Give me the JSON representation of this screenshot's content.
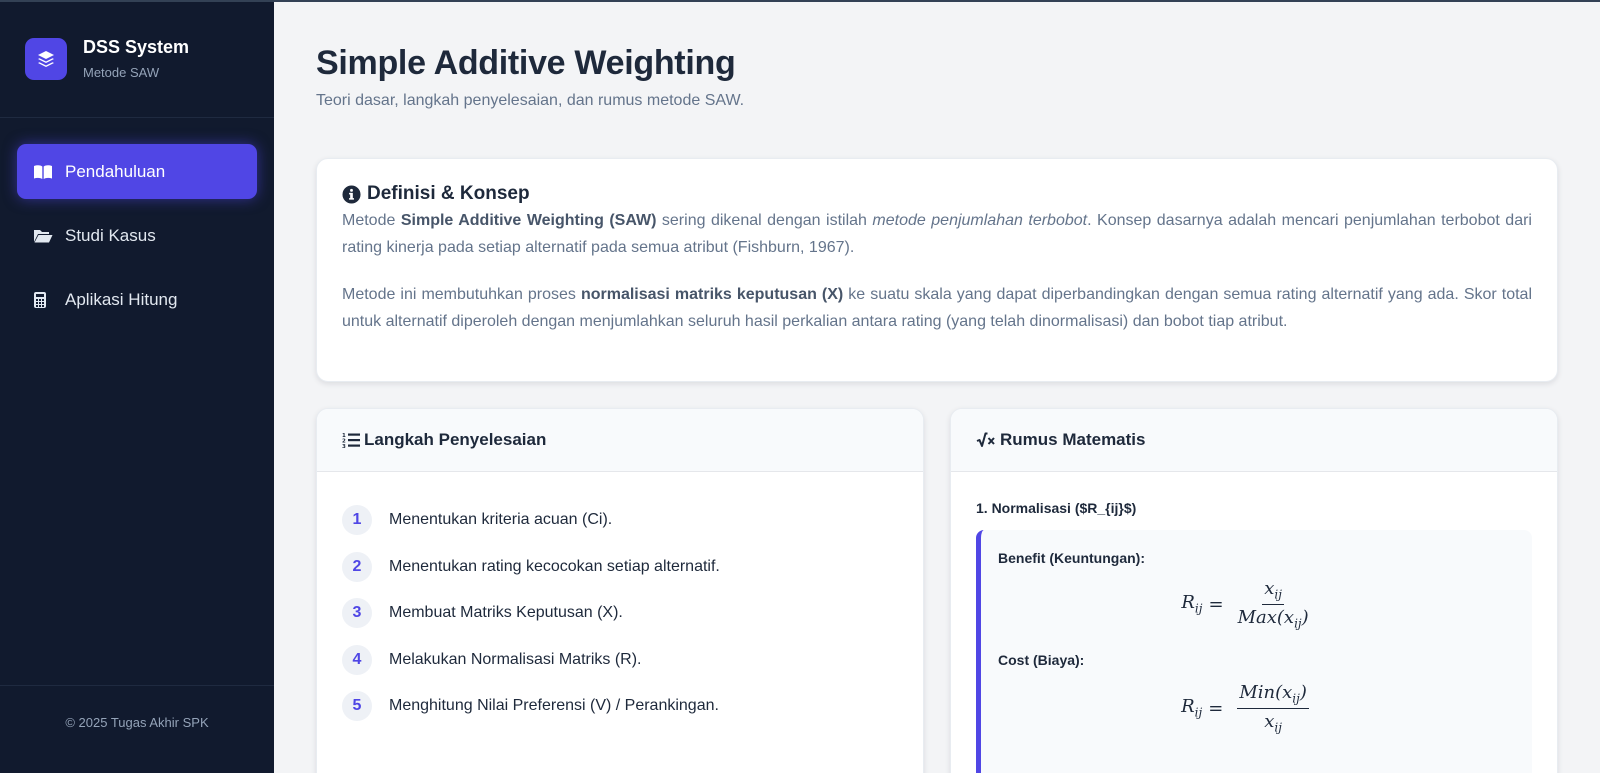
{
  "sidebar": {
    "brand_title": "DSS System",
    "brand_subtitle": "Metode SAW",
    "items": [
      {
        "label": "Pendahuluan",
        "icon": "book-open-icon",
        "active": true
      },
      {
        "label": "Studi Kasus",
        "icon": "folder-open-icon",
        "active": false
      },
      {
        "label": "Aplikasi Hitung",
        "icon": "calculator-icon",
        "active": false
      }
    ],
    "footer": "© 2025 Tugas Akhir SPK"
  },
  "header": {
    "title": "Simple Additive Weighting",
    "subtitle": "Teori dasar, langkah penyelesaian, dan rumus metode SAW."
  },
  "definition": {
    "title": "Definisi & Konsep",
    "icon": "info-circle-icon",
    "p1_a": "Metode ",
    "p1_bold": "Simple Additive Weighting (SAW)",
    "p1_b": " sering dikenal dengan istilah ",
    "p1_italic": "metode penjumlahan terbobot",
    "p1_c": ". Konsep dasarnya adalah mencari penjumlahan terbobot dari rating kinerja pada setiap alternatif pada semua atribut (Fishburn, 1967).",
    "p2_a": "Metode ini membutuhkan proses ",
    "p2_bold": "normalisasi matriks keputusan (X)",
    "p2_b": " ke suatu skala yang dapat diperbandingkan dengan semua rating alternatif yang ada. Skor total untuk alternatif diperoleh dengan menjumlahkan seluruh hasil perkalian antara rating (yang telah dinormalisasi) dan bobot tiap atribut."
  },
  "steps": {
    "title": "Langkah Penyelesaian",
    "icon": "list-ol-icon",
    "items": [
      {
        "num": "1",
        "text": "Menentukan kriteria acuan (Ci)."
      },
      {
        "num": "2",
        "text": "Menentukan rating kecocokan setiap alternatif."
      },
      {
        "num": "3",
        "text": "Membuat Matriks Keputusan (X)."
      },
      {
        "num": "4",
        "text": "Melakukan Normalisasi Matriks (R)."
      },
      {
        "num": "5",
        "text": "Menghitung Nilai Preferensi (V) / Perankingan."
      }
    ]
  },
  "formula": {
    "title": "Rumus Matematis",
    "icon": "square-root-icon",
    "norm_title": "1. Normalisasi ($R_{ij}$)",
    "benefit_label": "Benefit (Keuntungan):",
    "cost_label": "Cost (Biaya):",
    "benefit": {
      "lhs": "R",
      "lhs_sub": "ij",
      "num": "x",
      "num_sub": "ij",
      "den_pre": "Max(x",
      "den_sub": "ij",
      "den_post": ")"
    },
    "cost": {
      "lhs": "R",
      "lhs_sub": "ij",
      "num_pre": "Min(x",
      "num_sub": "ij",
      "num_post": ")",
      "den": "x",
      "den_sub": "ij"
    }
  },
  "colors": {
    "sidebar_bg": "#111a2e",
    "accent": "#5046e5",
    "page_bg": "#f3f4f6",
    "text_dark": "#1e293b",
    "text_muted": "#64748b"
  }
}
